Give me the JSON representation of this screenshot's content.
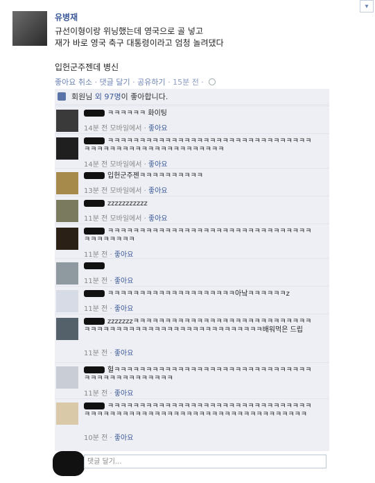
{
  "post": {
    "author": "유병재",
    "body": "규선이형이랑 위닝했는데 영국으로 골 넣고\n재가 바로 영국 축구 대통령이라고 엄청 놀려댔다",
    "body2": "입헌군주젠데 병신",
    "actions": {
      "unlike": "좋아요 취소",
      "comment": "댓글 달기",
      "share": "공유하기",
      "time": "15분 전"
    }
  },
  "likes": {
    "you": "회원님",
    "others": "외 97명",
    "suffix": "이 좋아합니다."
  },
  "comments": [
    {
      "text": "ㅋㅋㅋㅋㅋㅋ 화이팅",
      "time": "14분 전 모바일에서",
      "like": "좋아요"
    },
    {
      "text": "ㅋㅋㅋㅋㅋㅋㅋㅋㅋㅋㅋㅋㅋㅋㅋㅋㅋㅋㅋㅋㅋㅋㅋㅋㅋㅋㅋㅋㅋㅋㅋㅋㅋㅋㅋㅋㅋㅋㅋㅋㅋㅋㅋㅋㅋㅋㅋㅋㅋㅋㅋㅋㅋㅋ",
      "time": "14분 전 모바일에서",
      "like": "좋아요"
    },
    {
      "text": "입헌군주젠ㅋㅋㅋㅋㅋㅋㅋㅋㅋㅋ",
      "time": "13분 전 모바일에서",
      "like": "좋아요"
    },
    {
      "text": "zzzzzzzzzzz",
      "time": "11분 전 모바일에서",
      "like": "좋아요"
    },
    {
      "text": "ㅋㅋㅋㅋㅋㅋㅋㅋㅋㅋㅋㅋㅋㅋㅋㅋㅋㅋㅋㅋㅋㅋㅋㅋㅋㅋㅋㅋㅋㅋㅋㅋㅋㅋㅋㅋㅋㅋㅋㅋ",
      "time": "11분 전",
      "like": "좋아요"
    },
    {
      "text": "",
      "time": "11분 전",
      "like": "좋아요"
    },
    {
      "text": "ㅋㅋㅋㅋㅋㅋㅋㅋㅋㅋㅋㅋㅋㅋㅋㅋㅋㅋㅋㅋ아낰ㅋㅋㅋㅋㅋㅋz",
      "time": "11분 전",
      "like": "좋아요"
    },
    {
      "text": "zzzzzzzㅋㅋㅋㅋㅋㅋㅋㅋㅋㅋㅋㅋㅋㅋㅋㅋㅋㅋㅋㅋㅋㅋㅋㅋㅋㅋㅋㅋㅋㅋㅋㅋㅋㅋㅋㅋㅋㅋㅋㅋㅋㅋㅋㅋㅋㅋㅋㅋㅋㅋㅋㅋㅋㅋㅋㅋ배워먹은 드립",
      "time": "11분 전",
      "like": "좋아요"
    },
    {
      "text": "헐ㅋㅋㅋㅋㅋㅋㅋㅋㅋㅋㅋㅋㅋㅋㅋㅋㅋㅋㅋㅋㅋㅋㅋㅋㅋㅋㅋㅋㅋㅋㅋㅋㅋㅋㅋㅋㅋㅋㅋㅋㅋㅋㅋㅋㅋ",
      "time": "11분 전",
      "like": "좋아요"
    },
    {
      "text": "ㅋㅋㅋㅋㅋㅋㅋㅋㅋㅋㅋㅋㅋㅋㅋㅋㅋㅋㅋㅋㅋㅋㅋㅋㅋㅋㅋㅋㅋㅋㅋㅋㅋㅋㅋㅋㅋㅋㅋㅋㅋㅋㅋㅋㅋㅋㅋㅋㅋㅋㅋㅋㅋㅋㅋㅋㅋㅋㅋㅋㅋㅋㅋㅋㅋㅋㅋ",
      "time": "10분 전",
      "like": "좋아요"
    }
  ],
  "reply": {
    "placeholder": "댓글 달기..."
  },
  "icons": {
    "dropdown": "chevron-down-icon",
    "like": "thumbs-up-icon",
    "audience": "globe-icon"
  }
}
